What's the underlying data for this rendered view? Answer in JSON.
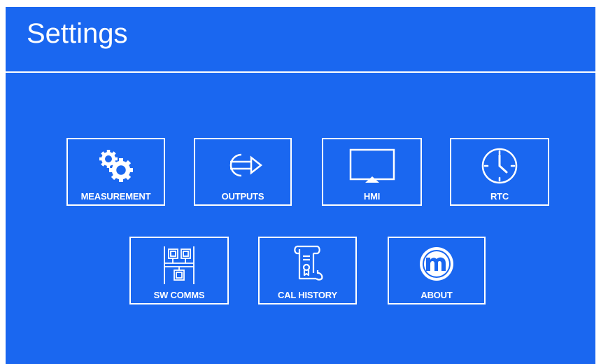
{
  "header": {
    "title": "Settings"
  },
  "menu": {
    "items": [
      {
        "id": "measurement",
        "label": "MEASUREMENT",
        "icon": "gears-icon"
      },
      {
        "id": "outputs",
        "label": "OUTPUTS",
        "icon": "output-arrow-icon"
      },
      {
        "id": "hmi",
        "label": "HMI",
        "icon": "monitor-icon"
      },
      {
        "id": "rtc",
        "label": "RTC",
        "icon": "clock-icon"
      },
      {
        "id": "swcomms",
        "label": "SW COMMS",
        "icon": "network-icon"
      },
      {
        "id": "calhistory",
        "label": "CAL HISTORY",
        "icon": "certificate-scroll-icon"
      },
      {
        "id": "about",
        "label": "ABOUT",
        "icon": "m-logo-icon"
      }
    ]
  },
  "colors": {
    "background": "#1a67f0",
    "foreground": "#ffffff"
  }
}
